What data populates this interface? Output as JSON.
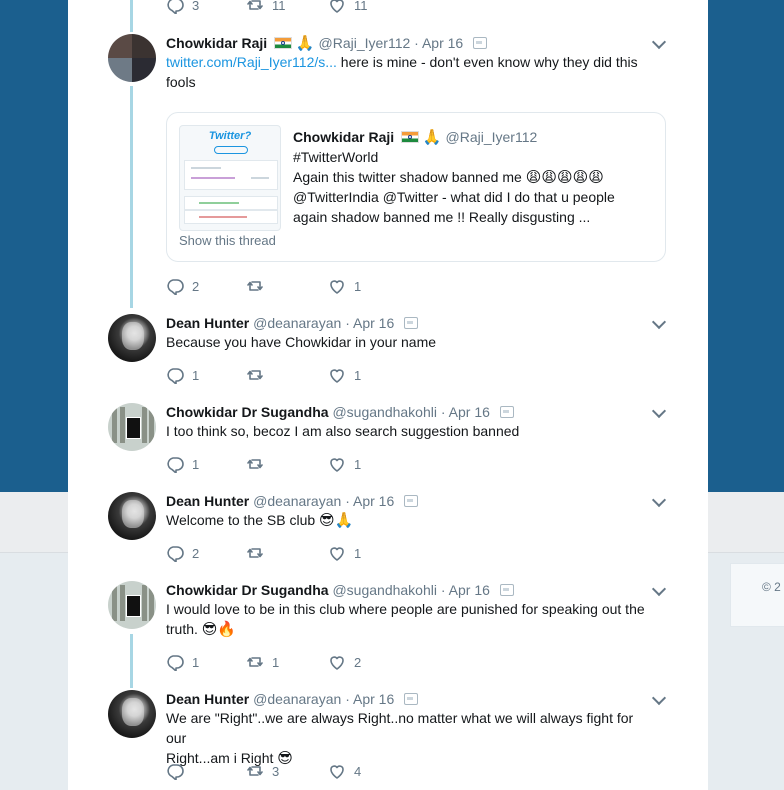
{
  "footer": {
    "copyright": "© 2"
  },
  "top_actions": {
    "reply_count": "3",
    "retweet_count": "11",
    "like_count": "11"
  },
  "tweets": [
    {
      "name": "Chowkidar Raji",
      "handle": "@Raji_Iyer112",
      "date": "Apr 16",
      "link": "twitter.com/Raji_Iyer112/s...",
      "text_line1": " here is mine - don't even know why they did this",
      "text_line2": "fools",
      "quote": {
        "name": "Chowkidar Raji",
        "handle": "@Raji_Iyer112",
        "line1": "#TwitterWorld",
        "line2": "Again this twitter shadow banned me",
        "line2_emoji": "😩😩😩😩😩",
        "line3": "@TwitterIndia @Twitter - what did I do that u people",
        "line4": "again shadow banned me !! Really disgusting ...",
        "show_thread": "Show this thread",
        "thumb_title": "Twitter?"
      },
      "replies": "2",
      "retweets": "",
      "likes": "1"
    },
    {
      "name": "Dean Hunter",
      "handle": "@deanarayan",
      "date": "Apr 16",
      "text_line1": "Because you have Chowkidar in your name",
      "replies": "1",
      "retweets": "",
      "likes": "1"
    },
    {
      "name": "Chowkidar Dr Sugandha",
      "handle": "@sugandhakohli",
      "date": "Apr 16",
      "text_line1": "I too think so, becoz I am also search suggestion banned",
      "replies": "1",
      "retweets": "",
      "likes": "1"
    },
    {
      "name": "Dean Hunter",
      "handle": "@deanarayan",
      "date": "Apr 16",
      "text_line1": "Welcome to the SB club ",
      "text_emoji": "😎🙏",
      "replies": "2",
      "retweets": "",
      "likes": "1"
    },
    {
      "name": "Chowkidar Dr Sugandha",
      "handle": "@sugandhakohli",
      "date": "Apr 16",
      "text_line1": "I would love to be in this club where people are punished for speaking out the",
      "text_line2": "truth. ",
      "text_emoji": "😎🔥",
      "replies": "1",
      "retweets": "1",
      "likes": "2"
    },
    {
      "name": "Dean Hunter",
      "handle": "@deanarayan",
      "date": "Apr 16",
      "text_line1": "We are \"Right\"..we are always Right..no matter what we will always fight for our",
      "text_line2": "Right...am i Right ",
      "text_emoji": "😎",
      "replies": "",
      "retweets": "3",
      "likes": "4"
    }
  ],
  "emoji": {
    "pray": "🙏"
  },
  "sep": "·"
}
